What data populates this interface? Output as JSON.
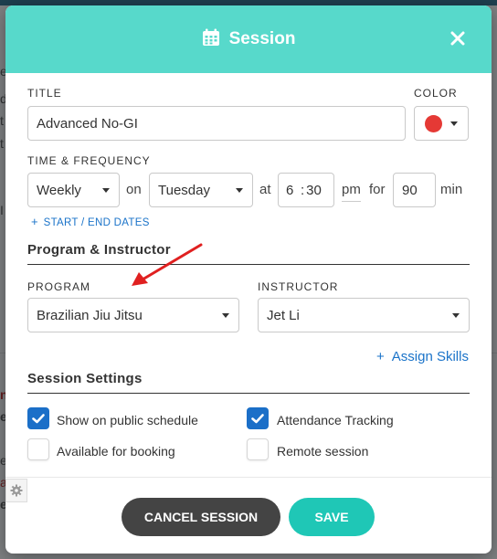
{
  "background": {
    "fragments": [
      "e",
      "d",
      "t",
      "t",
      "I",
      "ni",
      "er",
      "e",
      "a",
      "e"
    ]
  },
  "modal": {
    "title": "Session",
    "icon": "calendar-icon",
    "close_icon": "close-icon",
    "colors": {
      "header": "#57d9cb",
      "accent_blue": "#1b6fc8",
      "save": "#1fc7b6",
      "cancel": "#444444",
      "selected_color": "#e53935",
      "annotation_arrow": "#e02020"
    }
  },
  "title_section": {
    "title_label": "TITLE",
    "title_value": "Advanced No-GI",
    "color_label": "COLOR",
    "color_value": "#e53935"
  },
  "time_frequency": {
    "label": "TIME & FREQUENCY",
    "frequency": "Weekly",
    "on_text": "on",
    "day": "Tuesday",
    "at_text": "at",
    "hour": "6",
    "colon": ":",
    "minute": "30",
    "ampm": "pm",
    "for_text": "for",
    "duration": "90",
    "min_text": "min",
    "dates_link_plus": "+",
    "dates_link": "START / END DATES"
  },
  "program_instructor": {
    "section_title": "Program & Instructor",
    "program_label": "PROGRAM",
    "program_value": "Brazilian Jiu Jitsu",
    "instructor_label": "INSTRUCTOR",
    "instructor_value": "Jet Li",
    "assign_plus": "+",
    "assign_link": "Assign Skills"
  },
  "session_settings": {
    "section_title": "Session Settings",
    "options": [
      {
        "label": "Show on public schedule",
        "checked": true
      },
      {
        "label": "Attendance Tracking",
        "checked": true
      },
      {
        "label": "Available for booking",
        "checked": false
      },
      {
        "label": "Remote session",
        "checked": false
      }
    ]
  },
  "footer": {
    "cancel_label": "CANCEL SESSION",
    "save_label": "SAVE",
    "gear_icon": "gear-icon"
  }
}
